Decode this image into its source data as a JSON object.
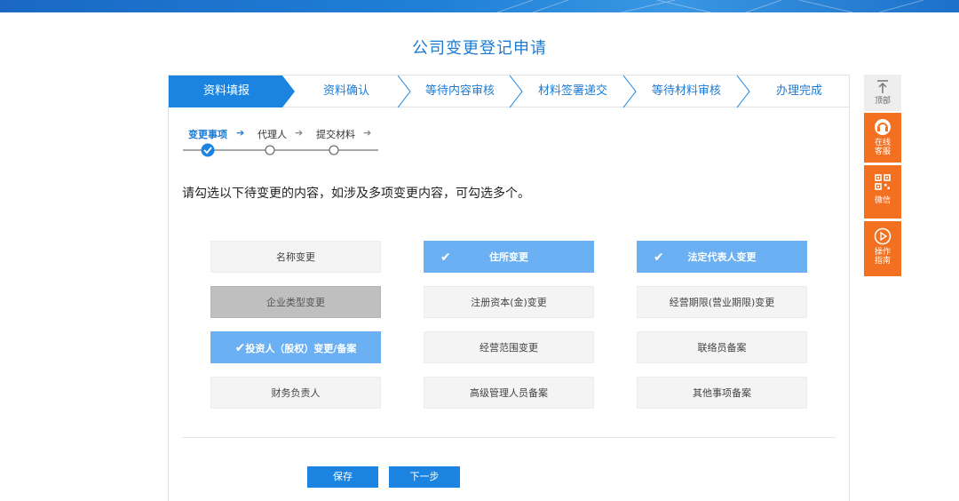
{
  "page": {
    "title": "公司变更登记申请"
  },
  "progress": {
    "steps": [
      {
        "label": "资料填报"
      },
      {
        "label": "资料确认"
      },
      {
        "label": "等待内容审核"
      },
      {
        "label": "材料签署递交"
      },
      {
        "label": "等待材料审核"
      },
      {
        "label": "办理完成"
      }
    ],
    "active_index": 0
  },
  "substeps": {
    "items": [
      {
        "label": "变更事项",
        "state": "done"
      },
      {
        "label": "代理人",
        "state": "pending"
      },
      {
        "label": "提交材料",
        "state": "pending"
      }
    ]
  },
  "instruction": "请勾选以下待变更的内容，如涉及多项变更内容，可勾选多个。",
  "options": [
    {
      "label": "名称变更",
      "state": "normal"
    },
    {
      "label": "住所变更",
      "state": "checked"
    },
    {
      "label": "法定代表人变更",
      "state": "checked"
    },
    {
      "label": "企业类型变更",
      "state": "disabled"
    },
    {
      "label": "注册资本(金)变更",
      "state": "normal"
    },
    {
      "label": "经营期限(营业期限)变更",
      "state": "normal"
    },
    {
      "label": "投资人（股权）变更/备案",
      "state": "checked"
    },
    {
      "label": "经营范围变更",
      "state": "normal"
    },
    {
      "label": "联络员备案",
      "state": "normal"
    },
    {
      "label": "财务负责人",
      "state": "normal"
    },
    {
      "label": "高级管理人员备案",
      "state": "normal"
    },
    {
      "label": "其他事项备案",
      "state": "normal"
    }
  ],
  "buttons": {
    "save": "保存",
    "next": "下一步"
  },
  "sidebar": {
    "top": {
      "icon": "arrow-up-to-top-icon",
      "label": "顶部"
    },
    "service": {
      "icon": "headset-icon",
      "label1": "在线",
      "label2": "客服"
    },
    "wechat": {
      "icon": "qr-code-icon",
      "label": "微信"
    },
    "guide": {
      "icon": "play-circle-icon",
      "label1": "操作",
      "label2": "指南"
    }
  },
  "colors": {
    "primary": "#1b7bd3",
    "checked": "#6ab0f3",
    "disabled": "#bfbfbf",
    "sidebar_accent": "#f37021"
  }
}
